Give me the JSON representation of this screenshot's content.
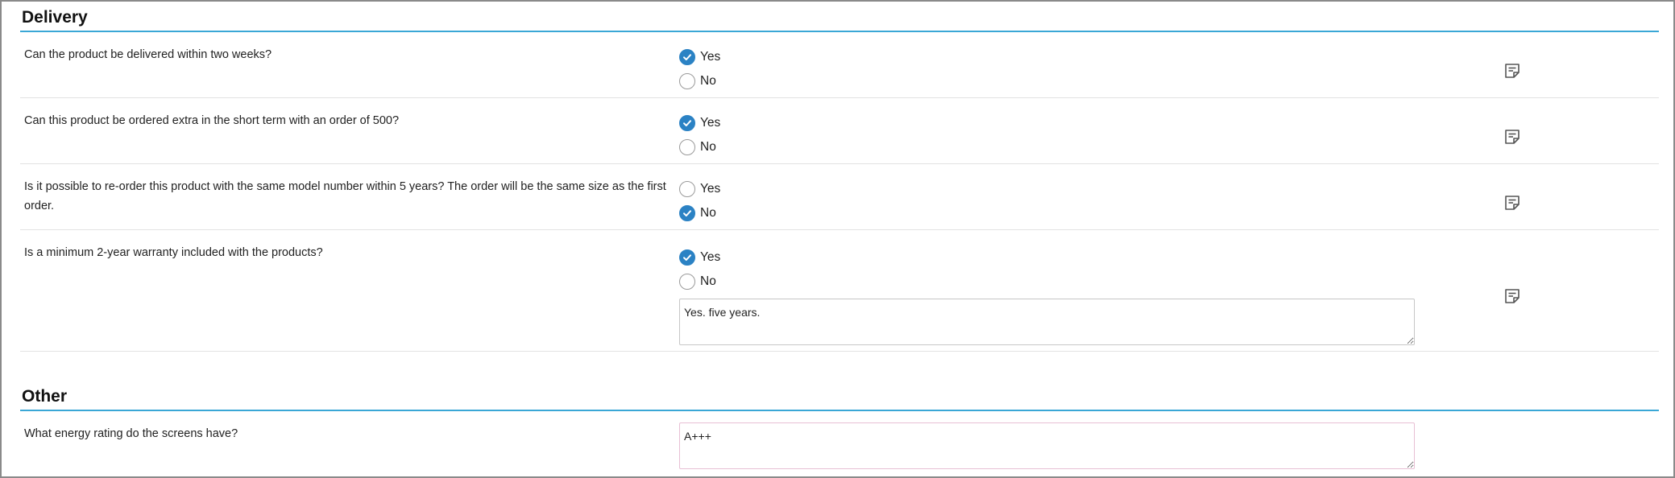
{
  "sections": [
    {
      "title": "Delivery",
      "questions": [
        {
          "text": "Can the product be delivered within two weeks?",
          "options": [
            "Yes",
            "No"
          ],
          "selected": "Yes"
        },
        {
          "text": "Can this product be ordered extra in the short term with an order of 500?",
          "options": [
            "Yes",
            "No"
          ],
          "selected": "Yes"
        },
        {
          "text": "Is it possible to re-order this product with the same model number within 5 years? The order will be the same size as the first order.",
          "options": [
            "Yes",
            "No"
          ],
          "selected": "No"
        },
        {
          "text": "Is a minimum 2-year warranty included with the products?",
          "options": [
            "Yes",
            "No"
          ],
          "selected": "Yes",
          "comment": "Yes. five years."
        }
      ]
    },
    {
      "title": "Other",
      "questions": [
        {
          "text": "What energy rating do the screens have?",
          "answer": "A+++"
        }
      ]
    }
  ],
  "icons": {
    "note": "note-icon",
    "check": "check-icon"
  },
  "colors": {
    "accent": "#2b82c4",
    "section_rule": "#3aa7d6"
  }
}
